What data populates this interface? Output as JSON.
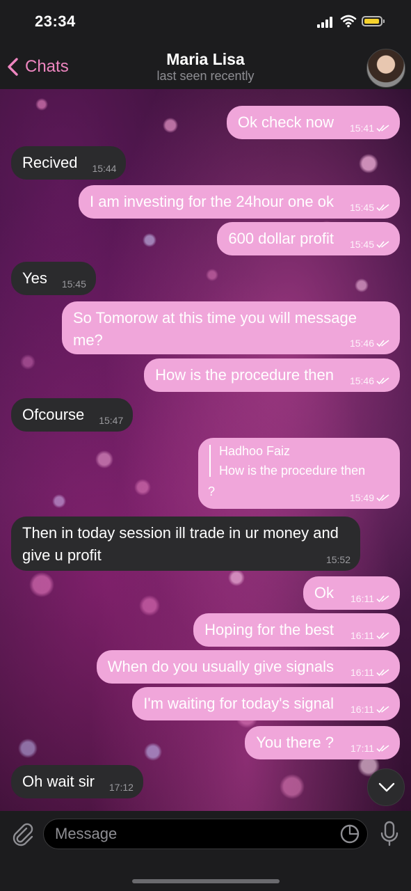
{
  "status_bar": {
    "time": "23:34"
  },
  "nav": {
    "back_label": "Chats",
    "title": "Maria Lisa",
    "subtitle": "last seen recently"
  },
  "messages": [
    {
      "dir": "out",
      "text": "Ok check now",
      "time": "15:41",
      "read": true
    },
    {
      "dir": "in",
      "text": "Recived",
      "time": "15:44"
    },
    {
      "dir": "out",
      "text": "I am investing for the 24hour one ok",
      "time": "15:45",
      "read": true
    },
    {
      "dir": "out",
      "text": "600 dollar profit",
      "time": "15:45",
      "read": true
    },
    {
      "dir": "in",
      "text": "Yes",
      "time": "15:45"
    },
    {
      "dir": "out",
      "text": "So Tomorow at this time you will message me?",
      "time": "15:46",
      "read": true
    },
    {
      "dir": "out",
      "text": "How is the procedure then",
      "time": "15:46",
      "read": true
    },
    {
      "dir": "in",
      "text": "Ofcourse",
      "time": "15:47"
    },
    {
      "dir": "out",
      "reply_name": "Hadhoo Faiz",
      "reply_text": "How is the procedure then",
      "text": "?",
      "time": "15:49",
      "read": true
    },
    {
      "dir": "in",
      "text": "Then  in today session  ill trade in ur money and give u profit",
      "time": "15:52"
    },
    {
      "dir": "out",
      "text": "Ok",
      "time": "16:11",
      "read": true
    },
    {
      "dir": "out",
      "text": "Hoping for the best",
      "time": "16:11",
      "read": true
    },
    {
      "dir": "out",
      "text": "When do you usually give signals",
      "time": "16:11",
      "read": true
    },
    {
      "dir": "out",
      "text": "I'm waiting for today's signal",
      "time": "16:11",
      "read": true
    },
    {
      "dir": "out",
      "text": "You there ?",
      "time": "17:11",
      "read": true
    },
    {
      "dir": "in",
      "text": "Oh wait sir",
      "time": "17:12"
    }
  ],
  "input": {
    "placeholder": "Message"
  },
  "colors": {
    "accent": "#ee86c0",
    "outgoing_bubble": "#f0a6da",
    "incoming_bubble": "#2b2b2d",
    "bar": "#1c1c1e"
  }
}
